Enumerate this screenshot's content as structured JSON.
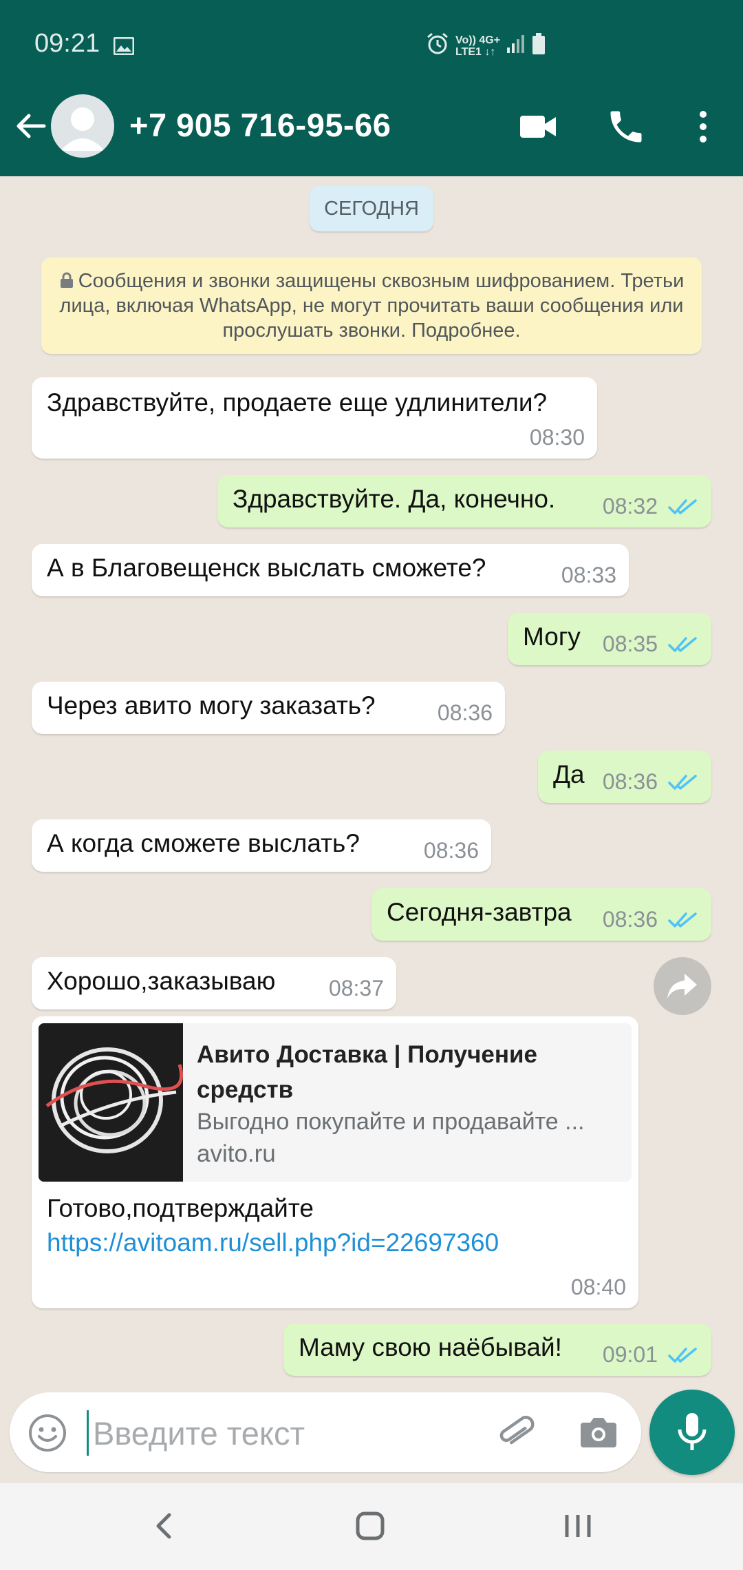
{
  "status_bar": {
    "time": "09:21",
    "network_top": "Vo)) 4G+",
    "network_bottom": "LTE1 ↓↑"
  },
  "header": {
    "contact_name": "+7 905 716-95-66",
    "icons": [
      "back-arrow-icon",
      "avatar-icon",
      "video-call-icon",
      "phone-icon",
      "more-vert-icon"
    ]
  },
  "chat": {
    "date_label": "СЕГОДНЯ",
    "encryption_notice": "Сообщения и звонки защищены сквозным шифрованием. Третьи лица, включая WhatsApp, не могут прочитать ваши сообщения или прослушать звонки. Подробнее.",
    "messages": [
      {
        "direction": "in",
        "text": "Здравствуйте, продаете еще удлинители?",
        "time": "08:30"
      },
      {
        "direction": "out",
        "text": "Здравствуйте. Да, конечно.",
        "time": "08:32",
        "read": true
      },
      {
        "direction": "in",
        "text": "А в Благовещенск выслать сможете?",
        "time": "08:33"
      },
      {
        "direction": "out",
        "text": "Могу",
        "time": "08:35",
        "read": true
      },
      {
        "direction": "in",
        "text": "Через авито могу заказать?",
        "time": "08:36"
      },
      {
        "direction": "out",
        "text": "Да",
        "time": "08:36",
        "read": true
      },
      {
        "direction": "in",
        "text": "А когда сможете выслать?",
        "time": "08:36"
      },
      {
        "direction": "out",
        "text": "Сегодня-завтра",
        "time": "08:36",
        "read": true
      },
      {
        "direction": "in",
        "text": "Хорошо,заказываю",
        "time": "08:37"
      },
      {
        "direction": "in",
        "link_preview": {
          "title": "Авито Доставка | Получение средств",
          "description": "Выгодно покупайте и продавайте ...",
          "domain": "avito.ru"
        },
        "text": "Готово,подтверждайте",
        "url": "https://avitoam.ru/sell.php?id=22697360",
        "time": "08:40"
      },
      {
        "direction": "out",
        "text": "Маму свою наёбывай!",
        "time": "09:01",
        "read": true
      }
    ]
  },
  "composer": {
    "placeholder": "Введите текст",
    "value": ""
  },
  "colors": {
    "header": "#075e54",
    "accent": "#128c7e",
    "outgoing_bubble": "#dcf8c6",
    "incoming_bubble": "#ffffff",
    "read_ticks": "#4fc3f7",
    "link": "#1f8fd6"
  }
}
